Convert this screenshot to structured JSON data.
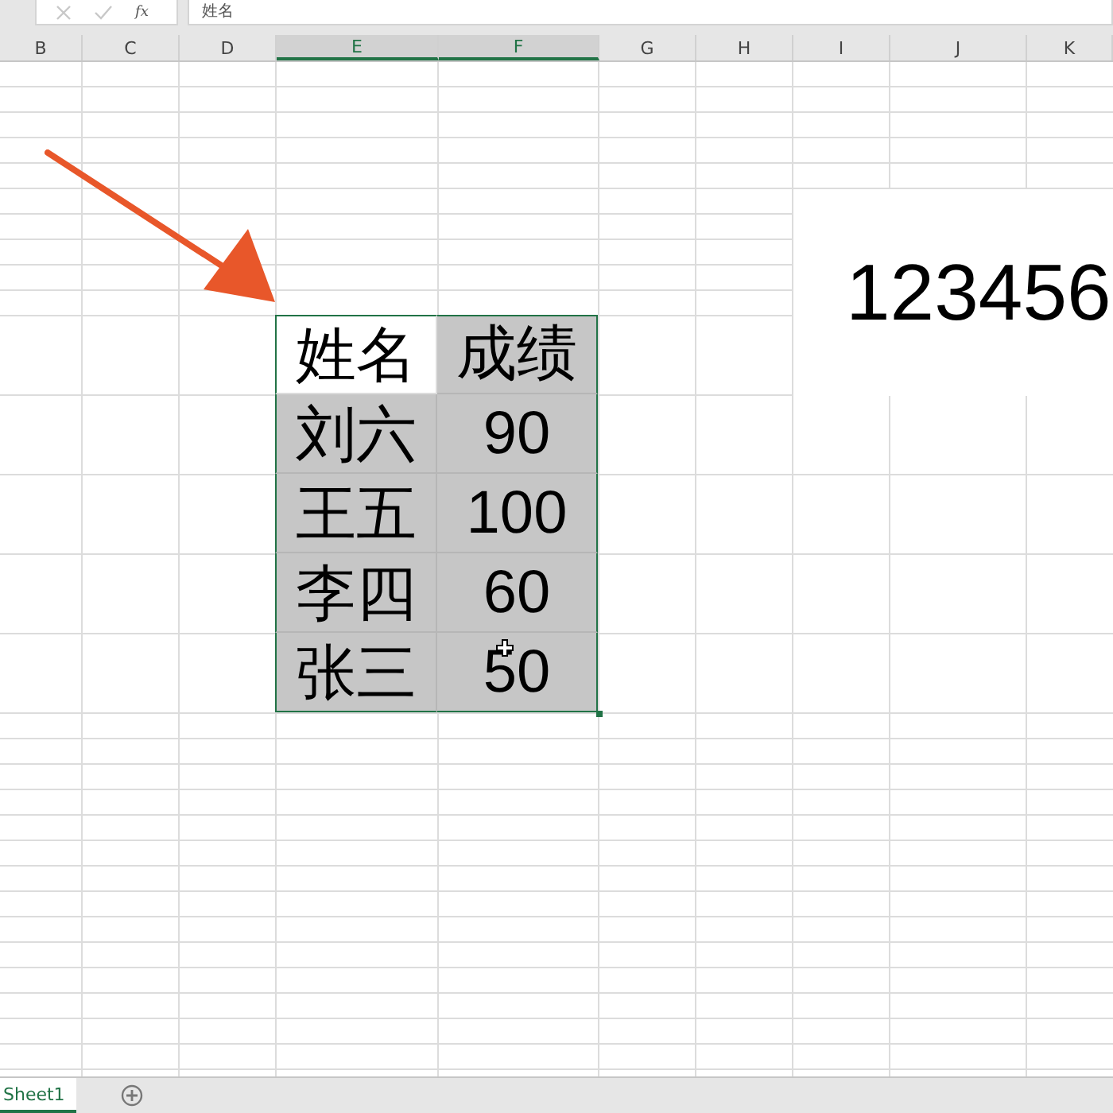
{
  "formula_bar": {
    "fx_label": "fx",
    "value": "姓名"
  },
  "column_headers": [
    {
      "label": "B",
      "selected": false
    },
    {
      "label": "C",
      "selected": false
    },
    {
      "label": "D",
      "selected": false
    },
    {
      "label": "E",
      "selected": true
    },
    {
      "label": "F",
      "selected": true
    },
    {
      "label": "G",
      "selected": false
    },
    {
      "label": "H",
      "selected": false
    },
    {
      "label": "I",
      "selected": false
    },
    {
      "label": "J",
      "selected": false
    },
    {
      "label": "K",
      "selected": false
    }
  ],
  "table": {
    "rows": [
      [
        {
          "text": "姓名",
          "active": true
        },
        {
          "text": "成绩",
          "active": false
        }
      ],
      [
        {
          "text": "刘六",
          "active": false
        },
        {
          "text": "90",
          "active": false
        }
      ],
      [
        {
          "text": "王五",
          "active": false
        },
        {
          "text": "100",
          "active": false
        }
      ],
      [
        {
          "text": "李四",
          "active": false
        },
        {
          "text": "60",
          "active": false
        }
      ],
      [
        {
          "text": "张三",
          "active": false
        },
        {
          "text": "50",
          "active": false
        }
      ]
    ]
  },
  "text_box": {
    "text": "123456"
  },
  "sheet_tabs": [
    {
      "label": "Sheet1",
      "selected": true
    }
  ]
}
